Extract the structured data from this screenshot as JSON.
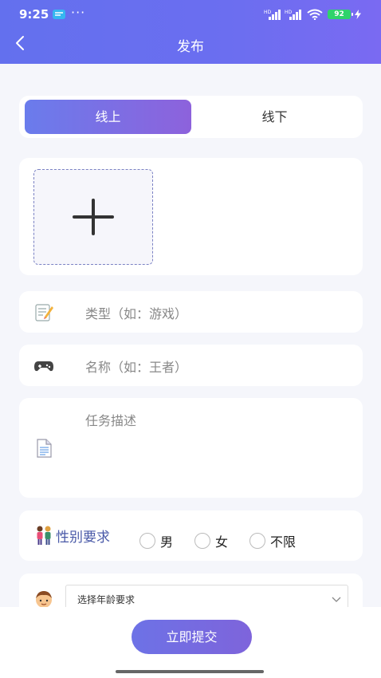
{
  "status_bar": {
    "time": "9:25",
    "more": "···",
    "signal_label": "HD",
    "battery": "92"
  },
  "nav": {
    "title": "发布",
    "back_icon": "back-arrow-icon"
  },
  "mode_tabs": [
    {
      "label": "线上",
      "active": true
    },
    {
      "label": "线下",
      "active": false
    }
  ],
  "upload": {
    "icon": "plus-icon"
  },
  "form": {
    "type_placeholder": "类型（如：游戏）",
    "name_placeholder": "名称（如：王者）",
    "desc_placeholder": "任务描述"
  },
  "gender": {
    "label": "性别要求",
    "options": [
      "男",
      "女",
      "不限"
    ]
  },
  "age": {
    "placeholder": "选择年龄要求"
  },
  "submit_label": "立即提交",
  "colors": {
    "accent": "#6b6ef0",
    "tab_active_start": "#6a7cec",
    "tab_active_end": "#8d62dc"
  }
}
